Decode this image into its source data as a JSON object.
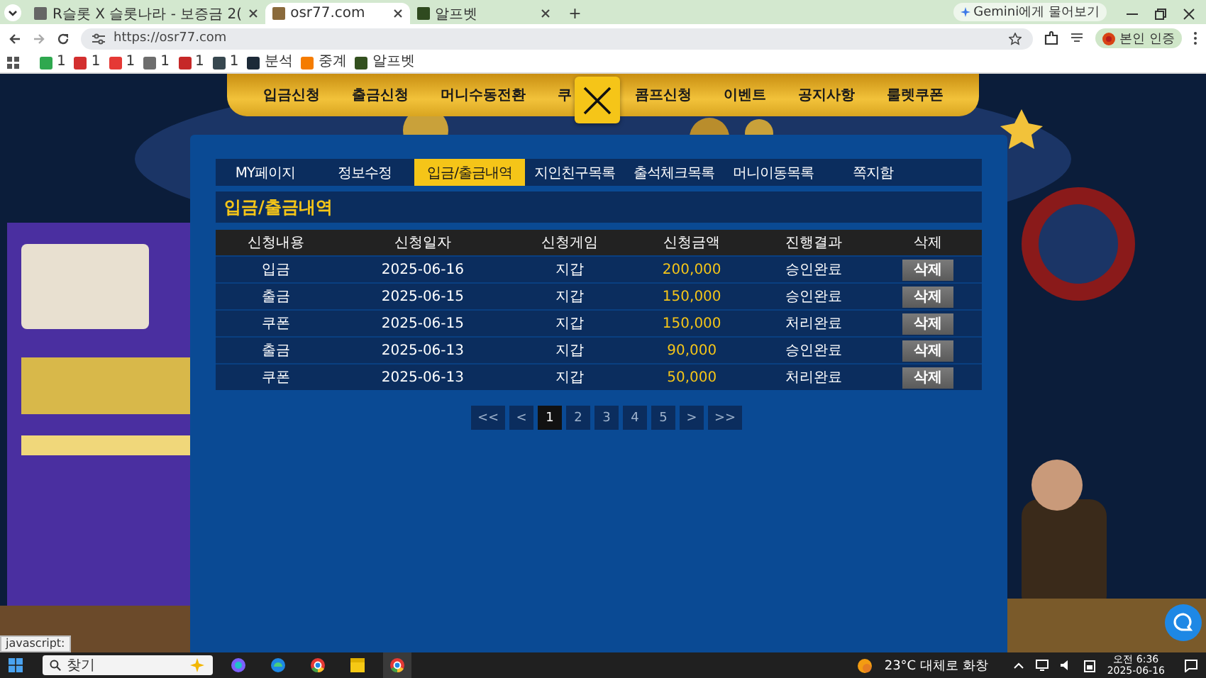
{
  "browser": {
    "tabs": [
      {
        "title": "R슬롯 X 슬롯나라 - 보증금 2(",
        "selected": false
      },
      {
        "title": "osr77.com",
        "selected": true
      },
      {
        "title": "알프벳",
        "selected": false
      }
    ],
    "new_tab": "+",
    "gemini_button": "Gemini에게 물어보기",
    "address": "https://osr77.com",
    "profile_button": "본인 인증",
    "bookmarks": [
      {
        "label": "1",
        "color": "#2fa84f"
      },
      {
        "label": "1",
        "color": "#d32f2f"
      },
      {
        "label": "1",
        "color": "#e53935"
      },
      {
        "label": "1",
        "color": "#6d6d6d"
      },
      {
        "label": "1",
        "color": "#c62828"
      },
      {
        "label": "1",
        "color": "#37474f"
      },
      {
        "label": "분석",
        "color": "#1c2a38"
      },
      {
        "label": "중계",
        "color": "#f57c00"
      },
      {
        "label": "알프벳",
        "color": "#33501f"
      }
    ]
  },
  "site": {
    "nav": [
      "입금신청",
      "출금신청",
      "머니수동전환",
      "쿠",
      "콤프신청",
      "이벤트",
      "공지사항",
      "룰렛쿠폰"
    ],
    "tabs": [
      {
        "label": "MY페이지",
        "selected": false
      },
      {
        "label": "정보수정",
        "selected": false
      },
      {
        "label": "입금/출금내역",
        "selected": true
      },
      {
        "label": "지인친구목록",
        "selected": false
      },
      {
        "label": "출석체크목록",
        "selected": false
      },
      {
        "label": "머니이동목록",
        "selected": false
      },
      {
        "label": "쪽지함",
        "selected": false
      }
    ],
    "section_title": "입금/출금내역",
    "table": {
      "columns": [
        "신청내용",
        "신청일자",
        "신청게임",
        "신청금액",
        "진행결과",
        "삭제"
      ],
      "rows": [
        {
          "type": "입금",
          "date": "2025-06-16",
          "game": "지갑",
          "amount": "200,000",
          "result": "승인완료",
          "action": "삭제"
        },
        {
          "type": "출금",
          "date": "2025-06-15",
          "game": "지갑",
          "amount": "150,000",
          "result": "승인완료",
          "action": "삭제"
        },
        {
          "type": "쿠폰",
          "date": "2025-06-15",
          "game": "지갑",
          "amount": "150,000",
          "result": "처리완료",
          "action": "삭제"
        },
        {
          "type": "출금",
          "date": "2025-06-13",
          "game": "지갑",
          "amount": "90,000",
          "result": "승인완료",
          "action": "삭제"
        },
        {
          "type": "쿠폰",
          "date": "2025-06-13",
          "game": "지갑",
          "amount": "50,000",
          "result": "처리완료",
          "action": "삭제"
        }
      ]
    },
    "pagination": [
      {
        "label": "<<",
        "selected": false
      },
      {
        "label": "<",
        "selected": false
      },
      {
        "label": "1",
        "selected": true
      },
      {
        "label": "2",
        "selected": false
      },
      {
        "label": "3",
        "selected": false
      },
      {
        "label": "4",
        "selected": false
      },
      {
        "label": "5",
        "selected": false
      },
      {
        "label": ">",
        "selected": false
      },
      {
        "label": ">>",
        "selected": false
      }
    ]
  },
  "status_bubble": "javascript:",
  "taskbar": {
    "search": {
      "placeholder": "찾기"
    },
    "weather": "23°C 대체로 화창",
    "time": "오전 6:36",
    "date": "2025-06-16"
  }
}
